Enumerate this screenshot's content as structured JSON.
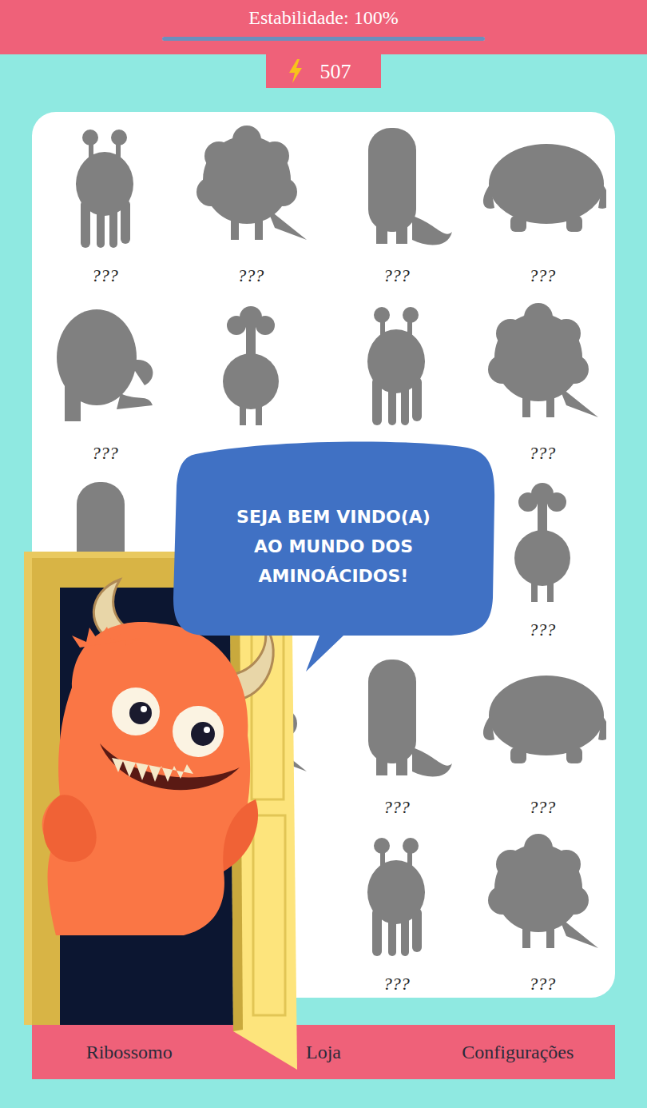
{
  "header": {
    "title": "Estabilidade: 100%",
    "stability": {
      "level": 1
    }
  },
  "energy": {
    "value": "507"
  },
  "collection": [
    {
      "label": "???"
    },
    {
      "label": "???"
    },
    {
      "label": "???"
    },
    {
      "label": "???"
    },
    {
      "label": "???"
    },
    {
      "label": ""
    },
    {
      "label": ""
    },
    {
      "label": "???"
    },
    {
      "label": ""
    },
    {
      "label": ""
    },
    {
      "label": ""
    },
    {
      "label": "???"
    },
    {
      "label": ""
    },
    {
      "label": ""
    },
    {
      "label": "???"
    },
    {
      "label": "???"
    },
    {
      "label": ""
    },
    {
      "label": ""
    },
    {
      "label": "???"
    },
    {
      "label": "???"
    }
  ],
  "bubble": {
    "lines": [
      "SEJA BEM VINDO(A)",
      "AO MUNDO DOS",
      "AMINOÁCIDOS!"
    ]
  },
  "nav": [
    {
      "label": "Ribossomo"
    },
    {
      "label": "Loja"
    },
    {
      "label": "Configurações"
    }
  ]
}
